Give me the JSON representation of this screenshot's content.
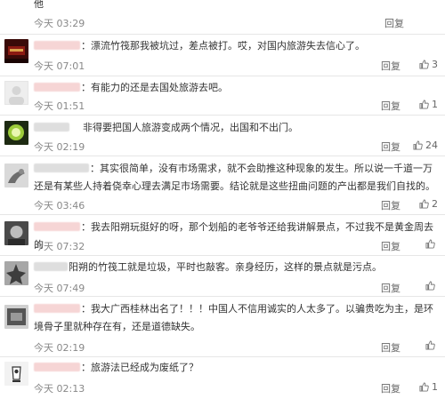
{
  "labels": {
    "reply": "回复"
  },
  "comments": [
    {
      "text": "他",
      "time": "今天 03:29",
      "likes": "",
      "show_like": false
    },
    {
      "text": "漂流竹筏那我被坑过，差点被打。哎，对国内旅游失去信心了。",
      "time": "今天 07:01",
      "likes": "3",
      "show_like": true
    },
    {
      "text": "有能力的还是去国处旅游去吧。",
      "time": "今天 01:51",
      "likes": "1",
      "show_like": true
    },
    {
      "text": "非得要把国人旅游变成两个情况，出国和不出门。",
      "time": "今天 02:19",
      "likes": "24",
      "show_like": true
    },
    {
      "text": "其实很简单，没有市场需求，就不会助推这种现象的发生。所以说一千道一万还是有某些人持着侥幸心理去满足市场需要。结论就是这些扭曲问题的产出都是我们自找的。",
      "time": "今天 03:46",
      "likes": "2",
      "show_like": true
    },
    {
      "text": "我去阳朔玩挺好的呀，那个划船的老爷爷还给我讲解景点，不过我不是黄金周去的",
      "time": "今天 07:32",
      "likes": "",
      "show_like": true
    },
    {
      "text": "阳朔的竹筏工就是垃圾，平时也敲客。亲身经历，这样的景点就是污点。",
      "time": "今天 07:49",
      "likes": "",
      "show_like": true
    },
    {
      "text": "我大广西桂林出名了！！！中国人不信用诚实的人太多了。以骗贵吃为主，是环境骨子里就种存在有，还是道德缺失。",
      "time": "今天 02:19",
      "likes": "",
      "show_like": true
    },
    {
      "text": "旅游法已经成为废纸了？",
      "time": "今天 02:13",
      "likes": "1",
      "show_like": true
    }
  ]
}
